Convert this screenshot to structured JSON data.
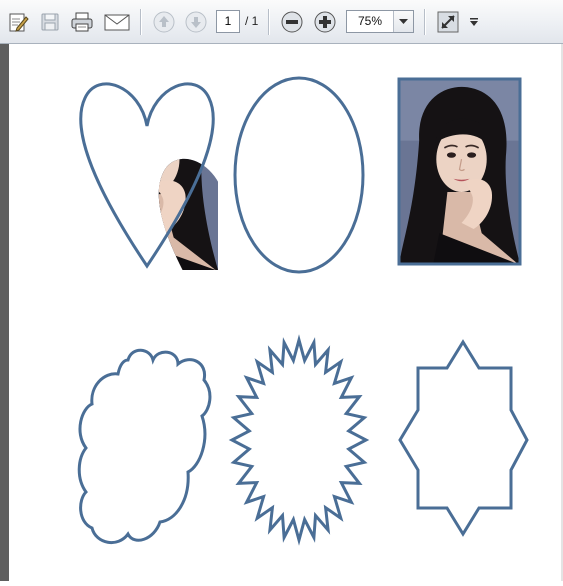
{
  "toolbar": {
    "page_current": "1",
    "page_total": "/ 1",
    "zoom_value": "75%",
    "icons": [
      "edit-icon",
      "save-icon",
      "print-icon",
      "email-icon",
      "prev-page-icon",
      "next-page-icon",
      "zoom-out-icon",
      "zoom-in-icon",
      "fit-page-icon",
      "more-tools-icon"
    ]
  },
  "document": {
    "photos": [
      {
        "name": "photo-heart",
        "shape": "heart"
      },
      {
        "name": "photo-oval",
        "shape": "oval"
      },
      {
        "name": "photo-rectangle",
        "shape": "rectangle"
      },
      {
        "name": "photo-cloud",
        "shape": "cloud"
      },
      {
        "name": "photo-starburst",
        "shape": "starburst"
      },
      {
        "name": "photo-star-polygon",
        "shape": "hexagon-star"
      }
    ],
    "frame_color": "#4a6e96"
  }
}
